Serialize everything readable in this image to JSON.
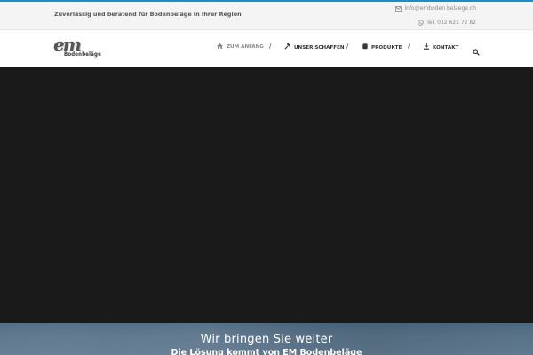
{
  "topbar": {
    "tagline": "Zuverlässig und beratend für Bodenbeläge in Ihrer Region",
    "email": "info@emboden belaege.ch",
    "phone": "Tel. 032 621 72 82"
  },
  "logo": {
    "mark": "em",
    "subtitle": "Bodenbeläge"
  },
  "nav": {
    "items": [
      {
        "label": "ZUM ANFANG",
        "icon": "home-icon",
        "active": true
      },
      {
        "label": "UNSER SCHAFFEN",
        "icon": "hammer-icon",
        "active": false
      },
      {
        "label": "PRODUKTE",
        "icon": "database-icon",
        "active": false
      },
      {
        "label": "KONTAKT",
        "icon": "download-icon",
        "active": false
      }
    ],
    "separator": "/",
    "search_icon": "search-icon"
  },
  "banner": {
    "title": "Wir bringen Sie weiter",
    "subtitle": "Die Lösung kommt von EM Bodenbeläge"
  },
  "colors": {
    "accent": "#1b8fc4",
    "hero": "#1a1a1a",
    "banner": "#5a7389"
  }
}
